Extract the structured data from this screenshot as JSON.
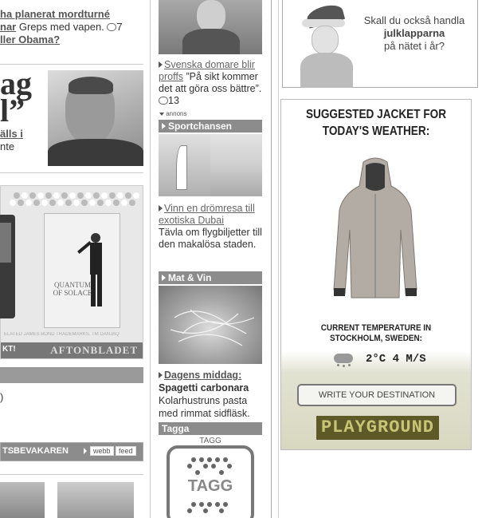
{
  "left_col": {
    "headline_top": "ha planerat mordturné",
    "headline_top2": "nar",
    "headline_top_rest": " Greps med vapen.",
    "comment_count_1": "7",
    "link_obama": "ller Obama?",
    "big_head_1": "ag",
    "big_head_2": "l”",
    "sub_link": "älls i",
    "sub_text": "nte",
    "movie_title": "Quantum of Solace",
    "disclaimer": "ELATED JAMES BOND TRADEMARKS. TM DANJAQ",
    "click_text": "KT!",
    "brand": "AFTONBLADET",
    "paren": ")",
    "watchers_label": "TSBEVAKAREN",
    "webb_label": "webb",
    "feed_label": "feed"
  },
  "mid_col": {
    "story1_link": "Svenska domare blir proffs",
    "story1_text": " ”På sikt kommer det att göra oss bättre”.",
    "story1_comments": "13",
    "annons": "annons",
    "section_sport": "Sportchansen",
    "story2_link": "Vinn en drömresa till exotiska Dubai",
    "story2_text": "Tävla om flygbiljetter till den makalösa staden.",
    "section_mat": "Mat & Vin",
    "story3_link": "Dagens middag:",
    "story3_title": "Spagetti carbonara",
    "story3_text": "Kolarhustruns pasta med rimmat sidfläsk.",
    "section_tagga": "Tagga",
    "tagg_small": "TAGG",
    "tagg_big": "TAGG"
  },
  "right_col": {
    "ad1_line1": "Skall du också handla",
    "ad1_line2": "julklapparna",
    "ad1_line3": "på nätet i år?",
    "ad2_title_1": "SUGGESTED JACKET FOR",
    "ad2_title_2": "TODAY'S WEATHER:",
    "ad2_temp_1": "CURRENT TEMPERATURE IN",
    "ad2_temp_2": "STOCKHOLM, SWEDEN:",
    "ad2_weather": "2°C 4 m/s",
    "ad2_button": "WRITE YOUR DESTINATION",
    "ad2_brand": "PLAYGROUND"
  },
  "colors": {
    "section_header": "#8c8c8c",
    "brand_text": "#3a3a1a",
    "brand_bg": "#6f6a2e"
  }
}
